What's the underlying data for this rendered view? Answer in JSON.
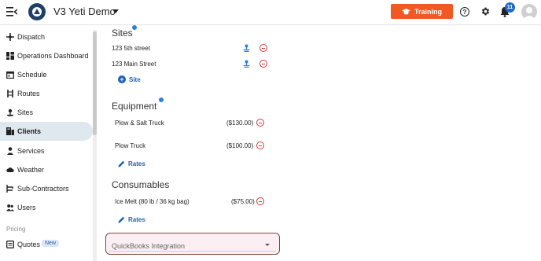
{
  "header": {
    "app_title": "V3 Yeti Demo",
    "training_label": "Training",
    "notification_count": "11",
    "help_glyph": "?"
  },
  "sidebar": {
    "items": [
      {
        "label": "Dispatch",
        "icon": "dispatch-icon"
      },
      {
        "label": "Operations Dashboard",
        "icon": "dashboard-icon"
      },
      {
        "label": "Schedule",
        "icon": "calendar-icon"
      },
      {
        "label": "Routes",
        "icon": "routes-icon"
      },
      {
        "label": "Sites",
        "icon": "sites-icon"
      },
      {
        "label": "Clients",
        "icon": "clients-icon",
        "active": true
      },
      {
        "label": "Services",
        "icon": "services-icon"
      },
      {
        "label": "Weather",
        "icon": "cloud-icon"
      },
      {
        "label": "Sub-Contractors",
        "icon": "subcontractors-icon"
      },
      {
        "label": "Users",
        "icon": "users-icon"
      }
    ],
    "section_pricing": "Pricing",
    "quotes": {
      "label": "Quotes",
      "badge": "New"
    }
  },
  "sites": {
    "heading": "Sites",
    "rows": [
      "123 5th street",
      "123 Main Street"
    ],
    "add_label": "Site"
  },
  "equipment": {
    "heading": "Equipment",
    "rows": [
      {
        "name": "Plow & Salt Truck",
        "price": "($130.00)"
      },
      {
        "name": "Plow Truck",
        "price": "($100.00)"
      }
    ],
    "rates_label": "Rates"
  },
  "consumables": {
    "heading": "Consumables",
    "rows": [
      {
        "name": "Ice Melt (80 lb / 36 kg bag)",
        "price": "($75.00)"
      }
    ],
    "rates_label": "Rates"
  },
  "quickbooks": {
    "label": "QuickBooks Integration"
  },
  "colors": {
    "accent": "#f05a22",
    "brand": "#1f3f66",
    "link": "#1c5fb8",
    "danger": "#d13a3a"
  }
}
